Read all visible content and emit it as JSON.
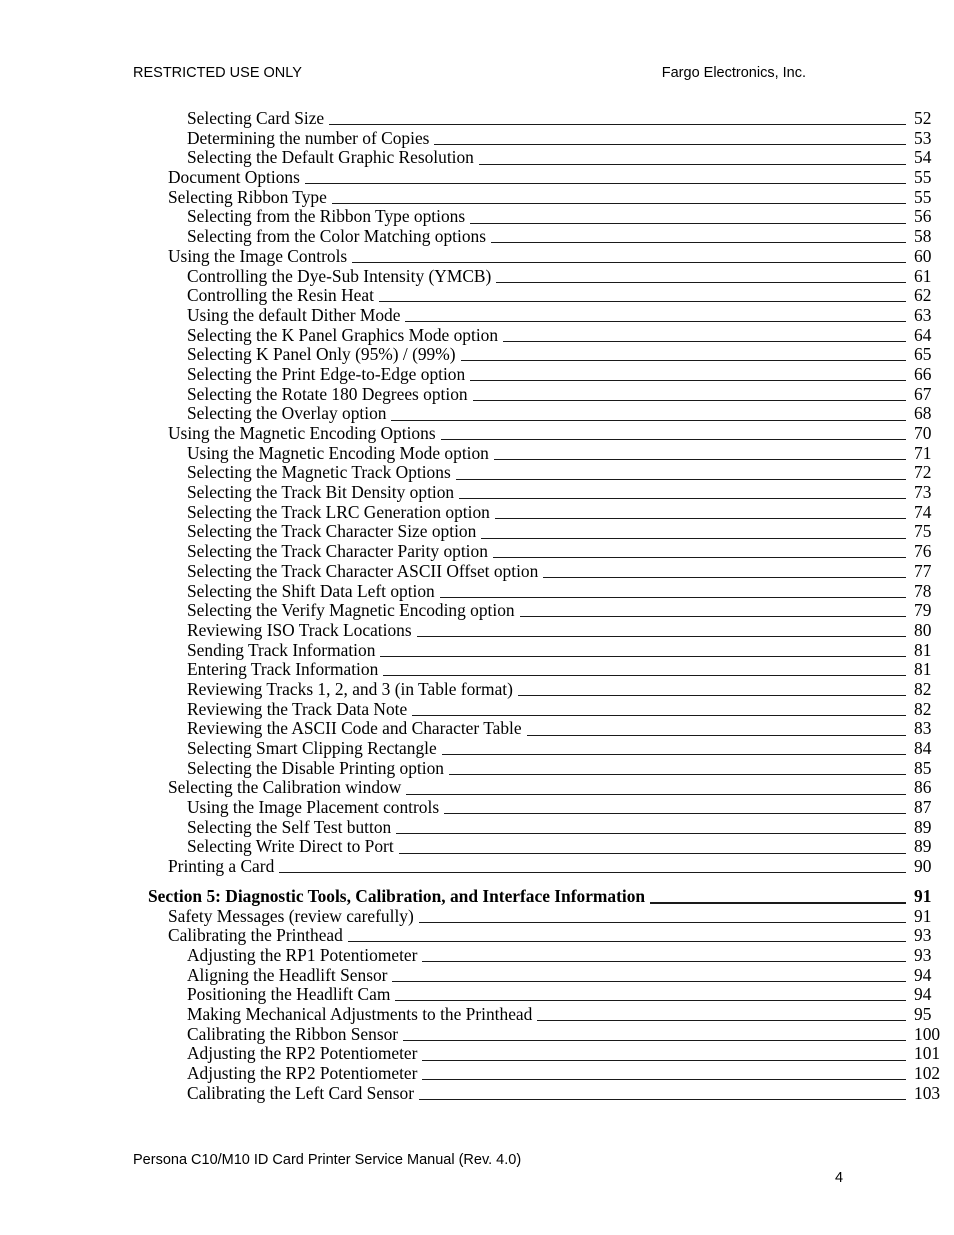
{
  "header": {
    "left": "RESTRICTED USE ONLY",
    "right": "Fargo Electronics, Inc."
  },
  "footer": {
    "document_title": "Persona C10/M10 ID Card Printer Service Manual (Rev. 4.0)",
    "page_number": "4"
  },
  "toc": {
    "entries": [
      {
        "label": "Selecting Card Size",
        "page": "52",
        "level": 2,
        "section": false,
        "gap_before": false
      },
      {
        "label": "Determining the number of Copies",
        "page": "53",
        "level": 2,
        "section": false,
        "gap_before": false
      },
      {
        "label": "Selecting the Default Graphic Resolution",
        "page": "54",
        "level": 2,
        "section": false,
        "gap_before": false
      },
      {
        "label": "Document Options",
        "page": "55",
        "level": 1,
        "section": false,
        "gap_before": false
      },
      {
        "label": "Selecting Ribbon Type",
        "page": "55",
        "level": 1,
        "section": false,
        "gap_before": false
      },
      {
        "label": "Selecting from the Ribbon Type options",
        "page": "56",
        "level": 2,
        "section": false,
        "gap_before": false
      },
      {
        "label": "Selecting from the Color Matching options",
        "page": "58",
        "level": 2,
        "section": false,
        "gap_before": false
      },
      {
        "label": "Using the Image Controls",
        "page": "60",
        "level": 1,
        "section": false,
        "gap_before": false
      },
      {
        "label": "Controlling the Dye-Sub Intensity (YMCB)",
        "page": "61",
        "level": 2,
        "section": false,
        "gap_before": false
      },
      {
        "label": "Controlling the Resin Heat",
        "page": "62",
        "level": 2,
        "section": false,
        "gap_before": false
      },
      {
        "label": "Using the default Dither Mode",
        "page": "63",
        "level": 2,
        "section": false,
        "gap_before": false
      },
      {
        "label": "Selecting the K Panel Graphics Mode option",
        "page": "64",
        "level": 2,
        "section": false,
        "gap_before": false
      },
      {
        "label": "Selecting K Panel Only (95%) / (99%)",
        "page": "65",
        "level": 2,
        "section": false,
        "gap_before": false
      },
      {
        "label": "Selecting the Print Edge-to-Edge option",
        "page": "66",
        "level": 2,
        "section": false,
        "gap_before": false
      },
      {
        "label": "Selecting the Rotate 180 Degrees option",
        "page": "67",
        "level": 2,
        "section": false,
        "gap_before": false
      },
      {
        "label": "Selecting the Overlay option",
        "page": "68",
        "level": 2,
        "section": false,
        "gap_before": false
      },
      {
        "label": "Using the Magnetic Encoding Options",
        "page": "70",
        "level": 1,
        "section": false,
        "gap_before": false
      },
      {
        "label": "Using the Magnetic Encoding Mode option",
        "page": "71",
        "level": 2,
        "section": false,
        "gap_before": false
      },
      {
        "label": "Selecting the Magnetic Track Options",
        "page": "72",
        "level": 2,
        "section": false,
        "gap_before": false
      },
      {
        "label": "Selecting the Track Bit Density option",
        "page": "73",
        "level": 2,
        "section": false,
        "gap_before": false
      },
      {
        "label": "Selecting the Track LRC Generation option",
        "page": "74",
        "level": 2,
        "section": false,
        "gap_before": false
      },
      {
        "label": "Selecting the Track Character Size option",
        "page": "75",
        "level": 2,
        "section": false,
        "gap_before": false
      },
      {
        "label": "Selecting the Track Character Parity option",
        "page": "76",
        "level": 2,
        "section": false,
        "gap_before": false
      },
      {
        "label": "Selecting the Track Character ASCII Offset option",
        "page": "77",
        "level": 2,
        "section": false,
        "gap_before": false
      },
      {
        "label": "Selecting the Shift Data Left option",
        "page": "78",
        "level": 2,
        "section": false,
        "gap_before": false
      },
      {
        "label": "Selecting the Verify Magnetic Encoding option",
        "page": "79",
        "level": 2,
        "section": false,
        "gap_before": false
      },
      {
        "label": "Reviewing ISO Track Locations",
        "page": "80",
        "level": 2,
        "section": false,
        "gap_before": false
      },
      {
        "label": "Sending Track Information",
        "page": "81",
        "level": 2,
        "section": false,
        "gap_before": false
      },
      {
        "label": "Entering Track Information",
        "page": "81",
        "level": 2,
        "section": false,
        "gap_before": false
      },
      {
        "label": "Reviewing Tracks 1, 2, and 3 (in Table format)",
        "page": "82",
        "level": 2,
        "section": false,
        "gap_before": false
      },
      {
        "label": "Reviewing the Track Data Note",
        "page": "82",
        "level": 2,
        "section": false,
        "gap_before": false
      },
      {
        "label": "Reviewing the ASCII Code and Character Table",
        "page": "83",
        "level": 2,
        "section": false,
        "gap_before": false
      },
      {
        "label": "Selecting Smart Clipping Rectangle",
        "page": "84",
        "level": 2,
        "section": false,
        "gap_before": false
      },
      {
        "label": "Selecting the Disable Printing option",
        "page": "85",
        "level": 2,
        "section": false,
        "gap_before": false
      },
      {
        "label": "Selecting the Calibration window",
        "page": "86",
        "level": 1,
        "section": false,
        "gap_before": false
      },
      {
        "label": "Using the Image Placement controls",
        "page": "87",
        "level": 2,
        "section": false,
        "gap_before": false
      },
      {
        "label": "Selecting the Self Test button",
        "page": "89",
        "level": 2,
        "section": false,
        "gap_before": false
      },
      {
        "label": "Selecting Write Direct to Port",
        "page": "89",
        "level": 2,
        "section": false,
        "gap_before": false
      },
      {
        "label": "Printing a Card",
        "page": "90",
        "level": 1,
        "section": false,
        "gap_before": false
      },
      {
        "label": "Section 5: Diagnostic Tools, Calibration, and Interface Information",
        "page": "91",
        "level": 0,
        "section": true,
        "gap_before": true
      },
      {
        "label": "Safety Messages (review carefully)",
        "page": "91",
        "level": 1,
        "section": false,
        "gap_before": false
      },
      {
        "label": "Calibrating the Printhead",
        "page": "93",
        "level": 1,
        "section": false,
        "gap_before": false
      },
      {
        "label": "Adjusting the RP1 Potentiometer",
        "page": "93",
        "level": 2,
        "section": false,
        "gap_before": false
      },
      {
        "label": "Aligning the Headlift Sensor",
        "page": "94",
        "level": 2,
        "section": false,
        "gap_before": false
      },
      {
        "label": "Positioning the Headlift Cam",
        "page": "94",
        "level": 2,
        "section": false,
        "gap_before": false
      },
      {
        "label": "Making Mechanical Adjustments to the Printhead",
        "page": "95",
        "level": 2,
        "section": false,
        "gap_before": false
      },
      {
        "label": "Calibrating the Ribbon Sensor",
        "page": "100",
        "level": 2,
        "section": false,
        "gap_before": false
      },
      {
        "label": "Adjusting the RP2 Potentiometer",
        "page": "101",
        "level": 2,
        "section": false,
        "gap_before": false
      },
      {
        "label": "Adjusting the RP2 Potentiometer",
        "page": "102",
        "level": 2,
        "section": false,
        "gap_before": false
      },
      {
        "label": "Calibrating the Left Card Sensor",
        "page": "103",
        "level": 2,
        "section": false,
        "gap_before": false
      }
    ]
  }
}
